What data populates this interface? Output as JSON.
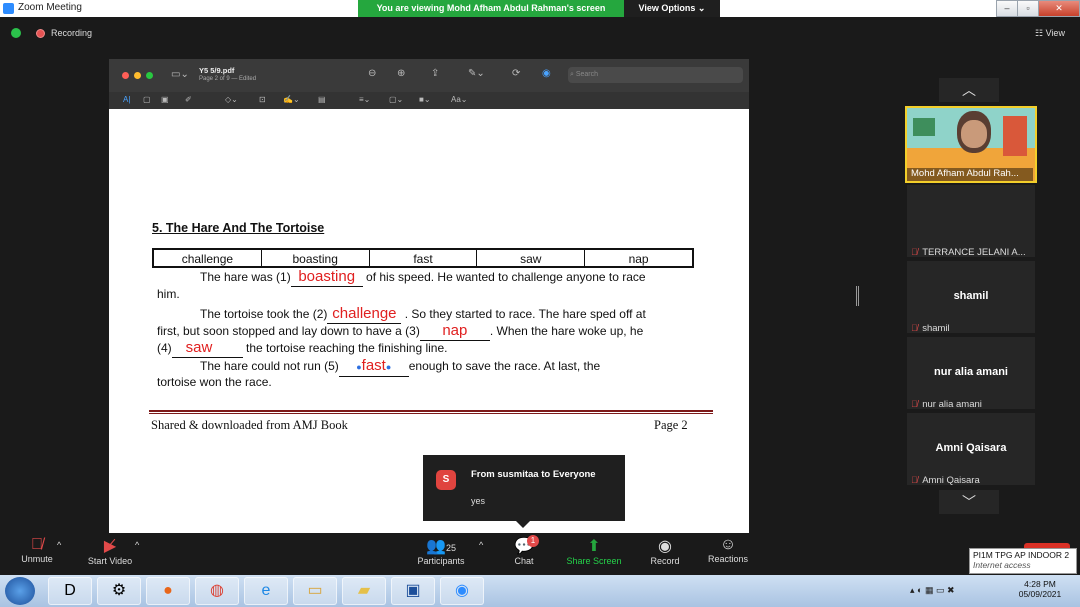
{
  "window": {
    "title": "Zoom Meeting",
    "viewing_banner": "You are viewing Mohd Afham Abdul Rahman's screen",
    "view_options": "View Options"
  },
  "header": {
    "recording": "Recording",
    "view_label": "View"
  },
  "preview": {
    "file_name": "Y5 5/9.pdf",
    "file_meta": "Page 2 of 9 — Edited",
    "search_placeholder": "Search"
  },
  "document": {
    "title": "5. The Hare And The Tortoise",
    "word_bank": [
      "challenge",
      "boasting",
      "fast",
      "saw",
      "nap"
    ],
    "p1_a": "The hare was (1)",
    "p1_ans": "boasting",
    "p1_b": " of his speed. He wanted to challenge anyone to race",
    "p1_c": "him.",
    "p2_a": "The tortoise took the (2)",
    "p2_ans": "challenge",
    "p2_b": " . So they started to race. The hare sped off at",
    "p2_c": "first, but soon stopped and lay down to have a (3)",
    "p2_ans2": "nap",
    "p2_d": ". When the hare woke up, he",
    "p2_e": "(4)",
    "p2_ans3": "saw",
    "p2_f": " the tortoise reaching the finishing line.",
    "p3_a": "The hare could not run (5)",
    "p3_ans": "fast",
    "p3_b": "enough to save the race. At last, the",
    "p3_c": "tortoise won the race.",
    "footer_left": "Shared & downloaded from AMJ Book",
    "footer_right": "Page 2"
  },
  "chat_popup": {
    "avatar": "S",
    "from": "From susmitaa to Everyone",
    "message": "yes"
  },
  "participants_panel": [
    {
      "name": "Mohd Afham Abdul Rah...",
      "type": "video"
    },
    {
      "name": "TERRANCE JELANI A...",
      "type": "muted_label"
    },
    {
      "title": "shamil",
      "name": "shamil"
    },
    {
      "title": "nur alia amani",
      "name": "nur alia amani"
    },
    {
      "title": "Amni Qaisara",
      "name": "Amni Qaisara"
    }
  ],
  "toolbar": {
    "unmute": "Unmute",
    "start_video": "Start Video",
    "participants": "Participants",
    "participants_count": "25",
    "chat": "Chat",
    "chat_badge": "1",
    "share_screen": "Share Screen",
    "record": "Record",
    "reactions": "Reactions"
  },
  "network_popup": {
    "name": "PI1M TPG AP INDOOR 2",
    "status": "Internet access"
  },
  "taskbar": {
    "time": "4:28 PM",
    "date": "05/09/2021"
  },
  "colors": {
    "viewing_green": "#25a73e",
    "answer_red": "#e02020",
    "share_green": "#25a73e"
  }
}
